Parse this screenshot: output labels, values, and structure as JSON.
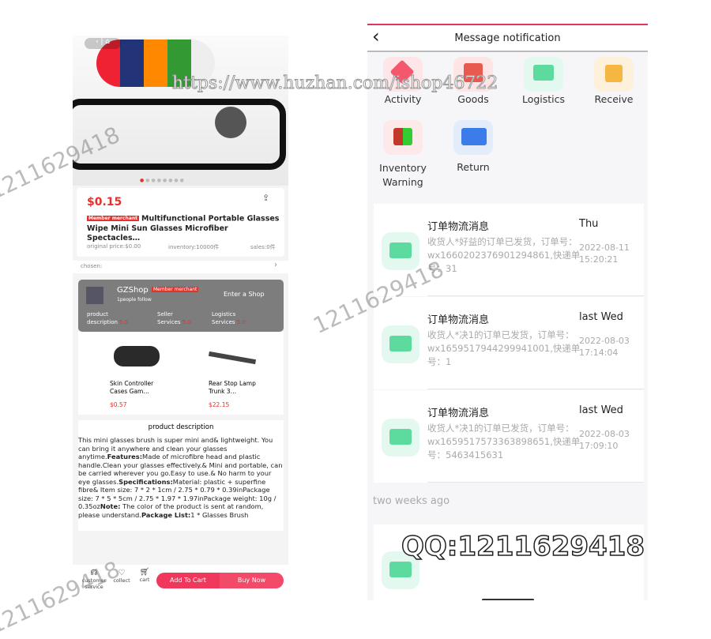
{
  "product": {
    "price": "$0.15",
    "member_tag": "Member merchant",
    "title": "Multifunctional Portable Glasses Wipe Mini Sun Glasses Microfiber Spectacles…",
    "original_price": "original price:$0.00",
    "inventory": "inventory:10000件",
    "sales": "sales:0件",
    "share": "share",
    "chosen": "chosen:"
  },
  "shop": {
    "name": "GZShop",
    "tag": "Member merchant",
    "follow": "1people follow",
    "enter": "Enter a Shop",
    "ratings": [
      {
        "label1": "product",
        "label2": "description",
        "score": "5.0"
      },
      {
        "label1": "Seller",
        "label2": "Services",
        "score": "5.0"
      },
      {
        "label1": "Logistics",
        "label2": "Services",
        "score": "5.0"
      }
    ]
  },
  "recommend": [
    {
      "name": "Skin Controller Cases Gam…",
      "price": "$0.57"
    },
    {
      "name": "Rear Stop Lamp Trunk 3…",
      "price": "$22.15"
    }
  ],
  "description": {
    "heading": "product description",
    "p1": "This mini glasses brush is super mini and&  lightweight. You can bring it anywhere and clean your glasses anytime.",
    "b1": "Features:",
    "p2": "Made of microfibre head and plastic handle.Clean your glasses effectively.& Mini and portable, can be carried wherever you go.Easy to use.& No harm to your eye glasses.",
    "b2": "Specifications:",
    "p3": "Material: plastic + superfine fibre& Item size: 7 * 2 * 1cm / 2.75 * 0.79 * 0.39inPackage size: 7 * 5 * 5cm / 2.75 * 1.97 * 1.97inPackage weight: 10g / 0.35oz",
    "b3": "Note:",
    "p4": " The color of the product is sent at random, please understand.",
    "b4": "Package List:",
    "p5": "1 * Glasses Brush"
  },
  "bottom": {
    "service": "customer service",
    "collect": "collect",
    "cart": "cart",
    "add": "Add To Cart",
    "buy": "Buy Now"
  },
  "notify": {
    "title": "Message notification",
    "categories": [
      {
        "label": "Activity",
        "color": "#f5576c"
      },
      {
        "label": "Goods",
        "color": "#e85a4f"
      },
      {
        "label": "Logistics",
        "color": "#5ddb9e"
      },
      {
        "label": "Receive",
        "color": "#f5b642"
      },
      {
        "label": "Inventory Warning",
        "color": "#c0392b"
      },
      {
        "label": "Return",
        "color": "#3b7bea"
      }
    ],
    "messages": [
      {
        "title": "订单物流消息",
        "body": "收货人*好益的订单已发货，订单号：wx1660202376901294861,快递单号：31",
        "day": "Thu",
        "date": "2022-08-11",
        "time": "15:20:21"
      },
      {
        "title": "订单物流消息",
        "body": "收货人*决1的订单已发货，订单号：wx1659517944299941001,快递单号：1",
        "day": "last Wed",
        "date": "2022-08-03",
        "time": "17:14:04"
      },
      {
        "title": "订单物流消息",
        "body": "收货人*决1的订单已发货，订单号：wx1659517573363898651,快递单号：5463415631",
        "day": "last Wed",
        "date": "2022-08-03",
        "time": "17:09:10"
      }
    ],
    "section": "two weeks ago"
  },
  "watermark": {
    "qq": "QQ:1211629418",
    "url": "https://www.huzhan.com/ishop46722",
    "num": "1211629418"
  }
}
